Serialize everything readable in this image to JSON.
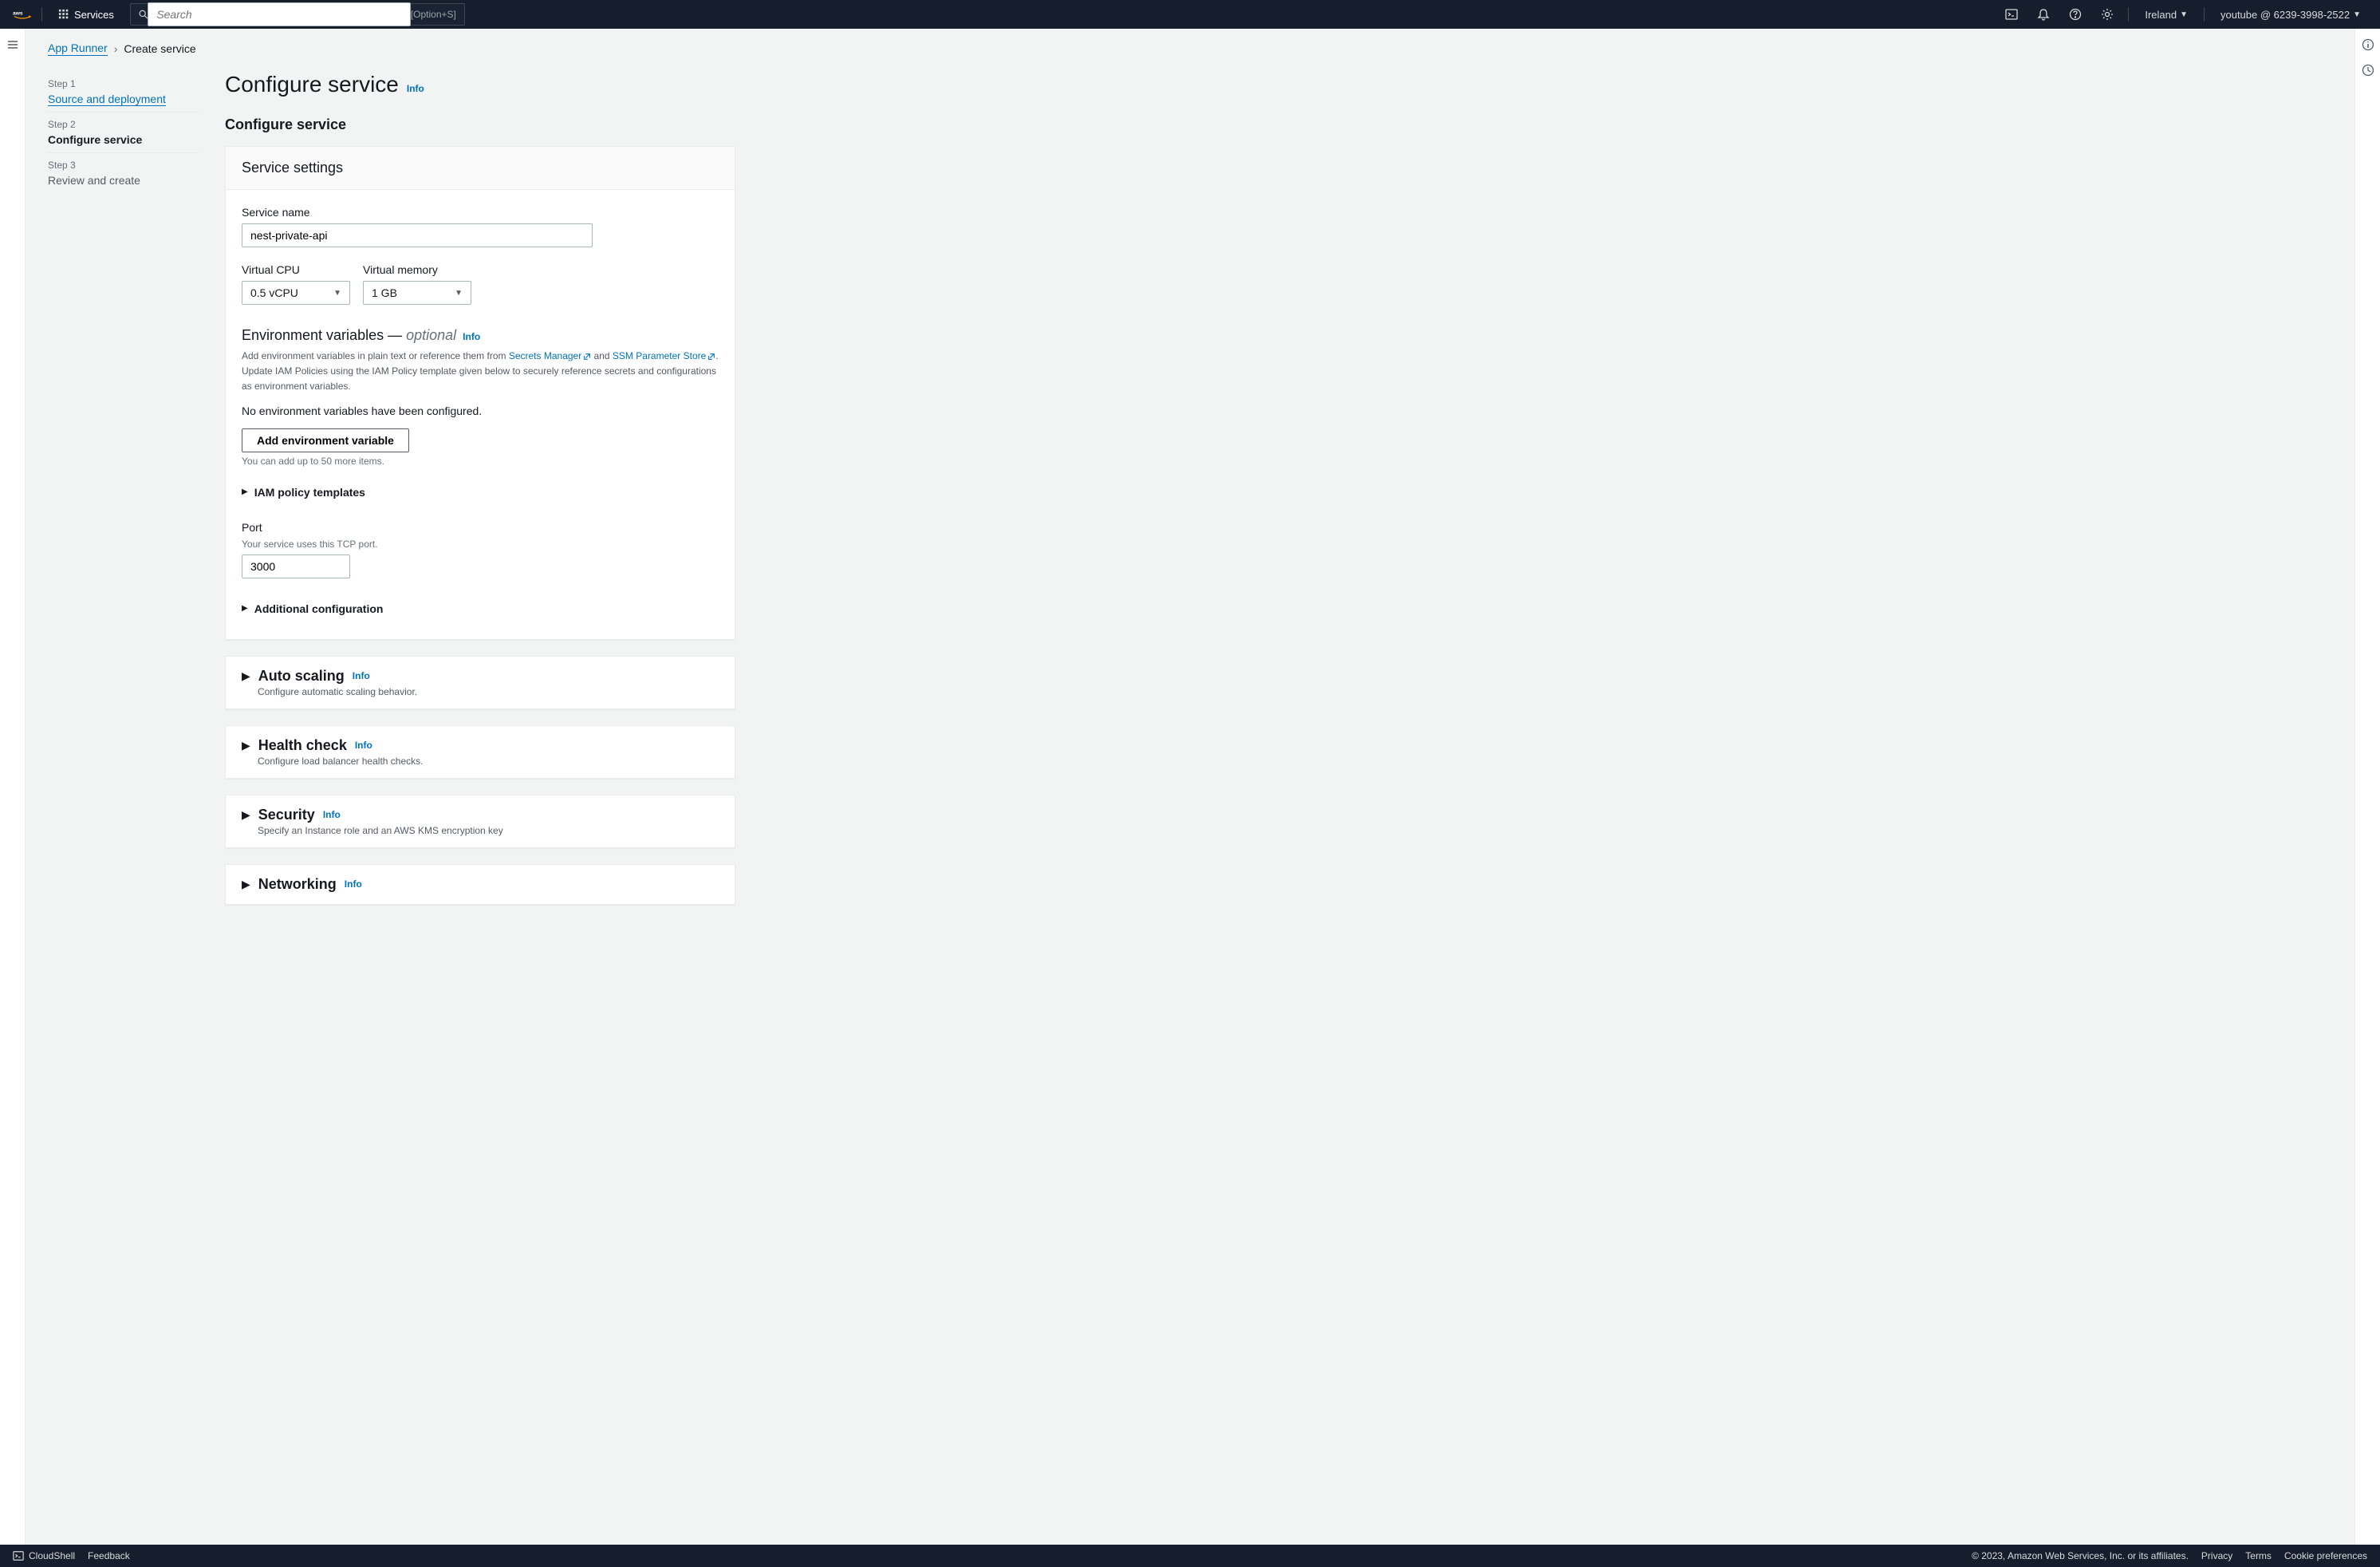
{
  "nav": {
    "services_label": "Services",
    "search_placeholder": "Search",
    "search_hint": "[Option+S]",
    "region": "Ireland",
    "account": "youtube @ 6239-3998-2522"
  },
  "breadcrumb": {
    "root": "App Runner",
    "current": "Create service"
  },
  "steps": [
    {
      "num": "Step 1",
      "name": "Source and deployment",
      "state": "link"
    },
    {
      "num": "Step 2",
      "name": "Configure service",
      "state": "active"
    },
    {
      "num": "Step 3",
      "name": "Review and create",
      "state": "muted"
    }
  ],
  "page": {
    "title": "Configure service",
    "info_label": "Info",
    "section_title": "Configure service"
  },
  "service_settings": {
    "panel_title": "Service settings",
    "service_name_label": "Service name",
    "service_name_value": "nest-private-api",
    "vcpu_label": "Virtual CPU",
    "vcpu_value": "0.5 vCPU",
    "vmem_label": "Virtual memory",
    "vmem_value": "1 GB"
  },
  "env_vars": {
    "title": "Environment variables —",
    "optional": "optional",
    "info_label": "Info",
    "desc_prefix": "Add environment variables in plain text or reference them from ",
    "link_secrets": "Secrets Manager",
    "desc_and": " and ",
    "link_ssm": "SSM Parameter Store",
    "desc_suffix": ". Update IAM Policies using the IAM Policy template given below to securely reference secrets and configurations as environment variables.",
    "empty_msg": "No environment variables have been configured.",
    "add_btn": "Add environment variable",
    "add_hint": "You can add up to 50 more items.",
    "iam_templates": "IAM policy templates"
  },
  "port": {
    "label": "Port",
    "help": "Your service uses this TCP port.",
    "value": "3000"
  },
  "additional_config": "Additional configuration",
  "sections": {
    "autoscaling": {
      "title": "Auto scaling",
      "info": "Info",
      "desc": "Configure automatic scaling behavior."
    },
    "healthcheck": {
      "title": "Health check",
      "info": "Info",
      "desc": "Configure load balancer health checks."
    },
    "security": {
      "title": "Security",
      "info": "Info",
      "desc": "Specify an Instance role and an AWS KMS encryption key"
    },
    "networking": {
      "title": "Networking",
      "info": "Info"
    }
  },
  "footer": {
    "cloudshell": "CloudShell",
    "feedback": "Feedback",
    "copyright": "© 2023, Amazon Web Services, Inc. or its affiliates.",
    "privacy": "Privacy",
    "terms": "Terms",
    "cookies": "Cookie preferences"
  }
}
